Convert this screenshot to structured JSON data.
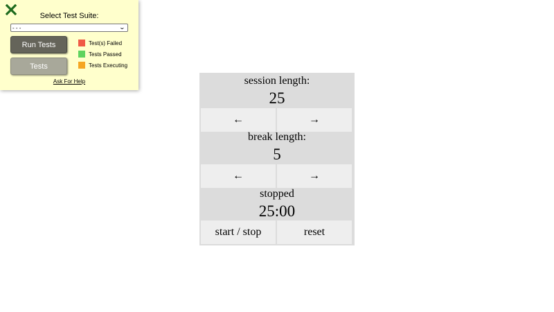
{
  "test_panel": {
    "title": "Select Test Suite:",
    "suite_select": {
      "selected": "- - -"
    },
    "run_tests_label": "Run Tests",
    "tests_label": "Tests",
    "legend": [
      {
        "label": "Test(s) Failed",
        "color": "#f05a46"
      },
      {
        "label": "Tests Passed",
        "color": "#5fd35f"
      },
      {
        "label": "Tests Executing",
        "color": "#f5a623"
      }
    ],
    "help_link": "Ask For Help",
    "close_icon": "close-icon",
    "close_color": "#1e6b1e",
    "background": "#ffffcc"
  },
  "pomodoro": {
    "session": {
      "label": "session length:",
      "value": "25",
      "decrement": "←",
      "increment": "→"
    },
    "break": {
      "label": "break length:",
      "value": "5",
      "decrement": "←",
      "increment": "→"
    },
    "timer": {
      "status": "stopped",
      "time": "25:00"
    },
    "controls": {
      "start_stop": "start / stop",
      "reset": "reset"
    },
    "colors": {
      "panel": "#dcdcdc",
      "button": "#eeeeee"
    }
  }
}
